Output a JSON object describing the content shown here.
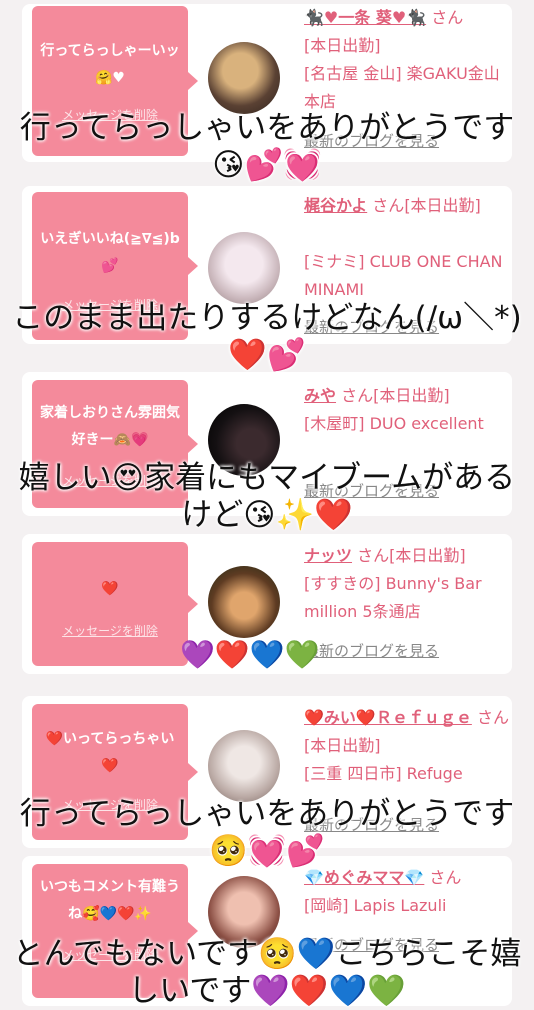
{
  "cards": [
    {
      "bubble_text": "行ってらっしゃーいッ🤗♥",
      "delete_label": "メッセージを削除",
      "name": "🐈‍⬛♥一条 葵♥🐈‍⬛",
      "honorific": "さん",
      "status": "[本日出勤]",
      "shop": "[名古屋 金山] 楽GAKU金山本店",
      "blog_label": "最新のブログを見る",
      "avatar_colors": [
        "#3b2a22",
        "#c9a26a"
      ]
    },
    {
      "bubble_text": "いえぎいいね(≧∇≦)b💕",
      "delete_label": "メッセージを削除",
      "name": "梶谷かよ",
      "honorific": "さん",
      "status": "[本日出勤]",
      "shop": "[ミナミ] CLUB ONE CHAN MINAMI",
      "blog_label": "最新のブログを見る",
      "avatar_colors": [
        "#e7e0ea",
        "#c8b3b0"
      ]
    },
    {
      "bubble_text": "家着しおりさん雰囲気好きー🙈💗",
      "delete_label": "メッセージを削除",
      "name": "みや",
      "honorific": "さん",
      "status": "[本日出勤]",
      "shop": "[木屋町] DUO excellent",
      "blog_label": "最新のブログを見る",
      "avatar_colors": [
        "#0d0d0d",
        "#2a1f22"
      ]
    },
    {
      "bubble_text": "❤️",
      "delete_label": "メッセージを削除",
      "name": "ナッツ",
      "honorific": "さん",
      "status": "[本日出勤]",
      "shop": "[すすきの] Bunny's Bar million 5条通店",
      "blog_label": "最新のブログを見る",
      "avatar_colors": [
        "#2d3a1e",
        "#c27a3a"
      ]
    },
    {
      "bubble_text": "❤️いってらっちゃい❤️",
      "delete_label": "メッセージを削除",
      "name": "❤️みい❤️Ｒｅｆｕｇｅ",
      "honorific": "さん",
      "status": "[本日出勤]",
      "shop": "[三重 四日市] Refuge",
      "blog_label": "最新のブログを見る",
      "avatar_colors": [
        "#d9d0cf",
        "#a38c86"
      ]
    },
    {
      "bubble_text": "いつもコメント有難うね🥰💙❤️✨",
      "delete_label": "メッセージを削除",
      "name": "💎めぐみママ💎",
      "honorific": "さん",
      "status": "",
      "shop": "[岡崎] Lapis Lazuli",
      "blog_label": "最新のブログを見る",
      "avatar_colors": [
        "#6b3b33",
        "#d9a796"
      ]
    }
  ],
  "overlays": [
    "行ってらっしゃいをありがとうです😘💕💓",
    "このまま出たりするけどなん(/ω＼*)❤️💕",
    "嬉しい😍家着にもマイブームがあるけど😘✨❤️",
    "💜❤️💙💚",
    "行ってらっしゃいをありがとうです🥺💓💕",
    "とんでもないです🥺💙こちらこそ嬉しいです💜❤️💙💚"
  ]
}
